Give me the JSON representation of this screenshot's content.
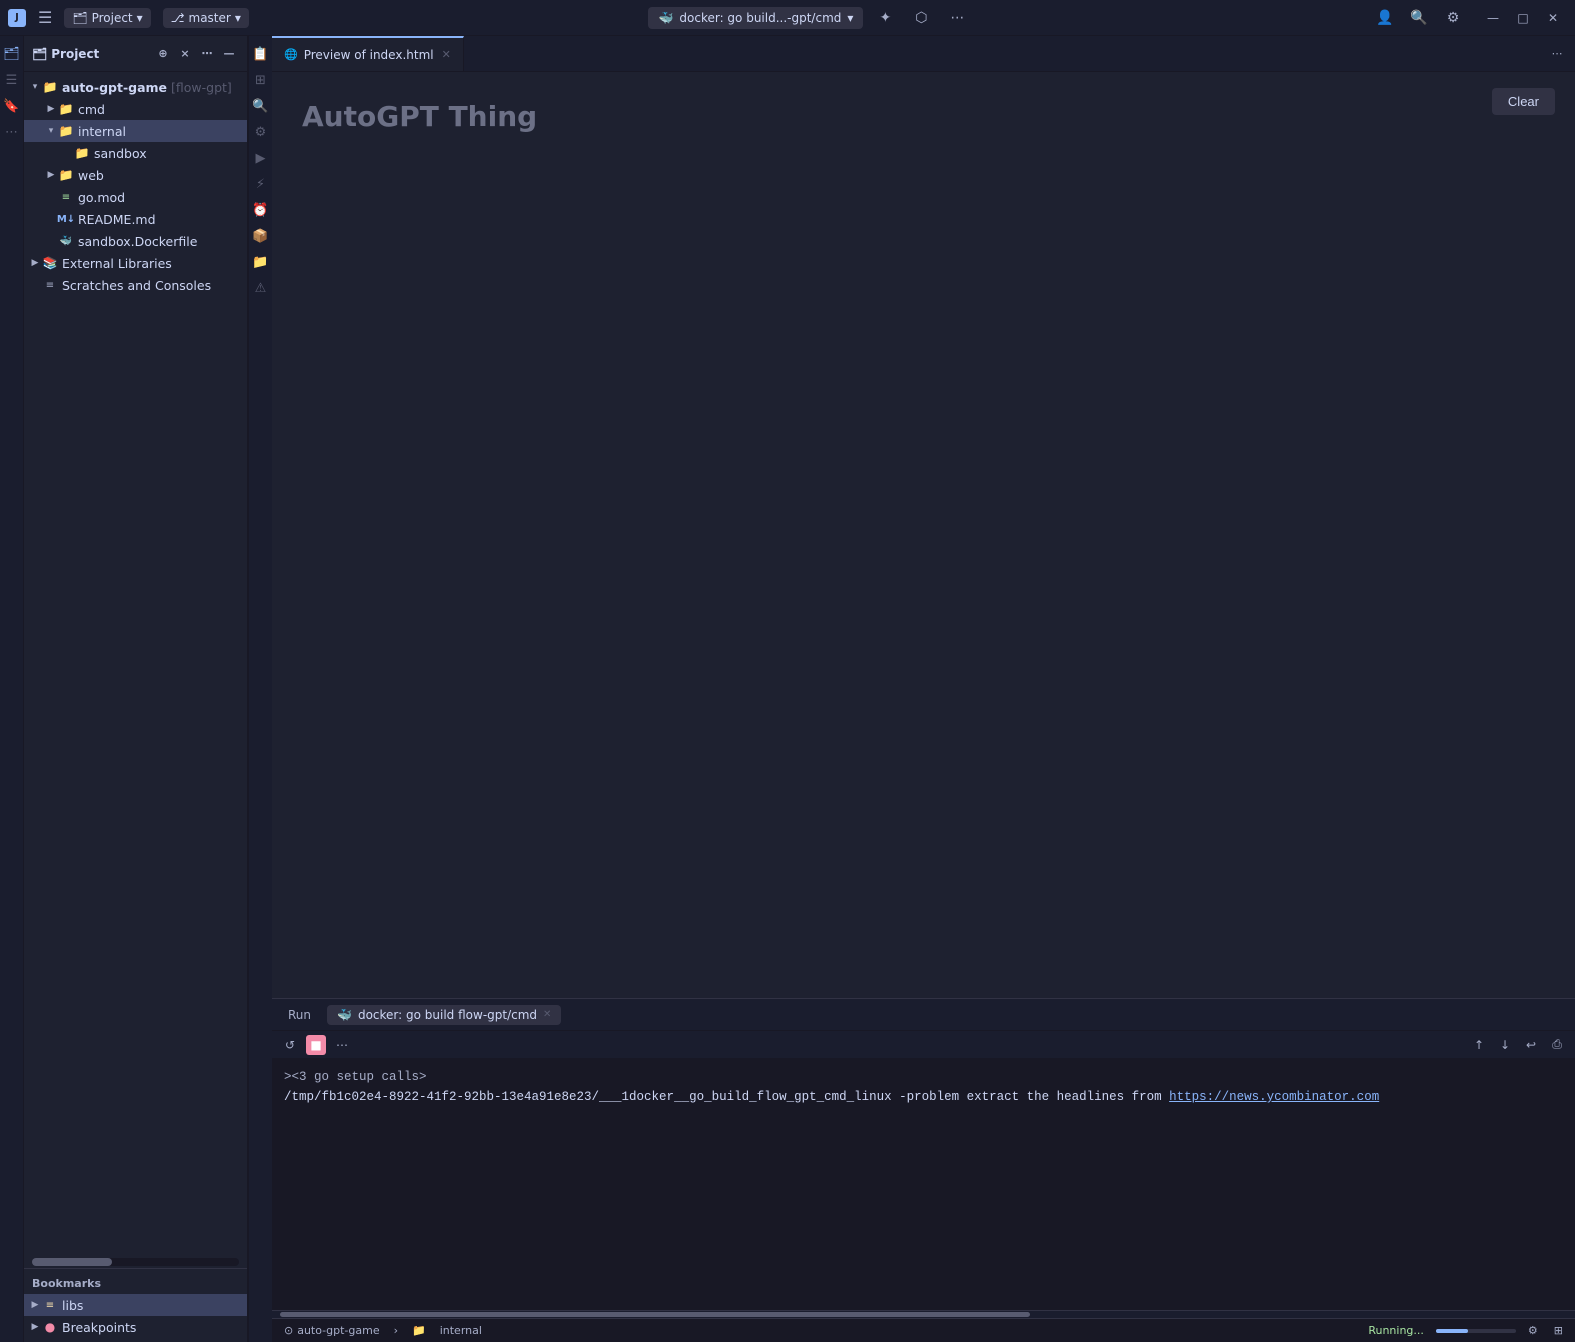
{
  "titlebar": {
    "logo": "J",
    "menu_icon": "☰",
    "project_label": "Project",
    "project_dropdown": "▾",
    "branch_icon": "⎇",
    "branch_name": "master",
    "branch_dropdown": "▾",
    "run_tab_icon": "🐳",
    "run_tab_label": "docker: go build...-gpt/cmd",
    "run_tab_dropdown": "▾",
    "actions": {
      "ai_icon": "✦",
      "plugin_icon": "⬡",
      "more_icon": "⋯",
      "profile_icon": "👤",
      "search_icon": "🔍",
      "settings_icon": "⚙",
      "minimize": "—",
      "maximize": "□",
      "close": "✕"
    }
  },
  "file_panel": {
    "title": "Project",
    "header_actions": [
      "⊕",
      "×",
      "⋯",
      "—"
    ],
    "tree": [
      {
        "level": 0,
        "type": "folder-open",
        "label": "auto-gpt-game [flow-gpt]",
        "chevron": "▾",
        "has_bold": true
      },
      {
        "level": 1,
        "type": "folder",
        "label": "cmd",
        "chevron": "▶"
      },
      {
        "level": 1,
        "type": "folder-open",
        "label": "internal",
        "chevron": "▾",
        "selected": true
      },
      {
        "level": 2,
        "type": "folder",
        "label": "sandbox",
        "chevron": ""
      },
      {
        "level": 1,
        "type": "folder",
        "label": "web",
        "chevron": "▶"
      },
      {
        "level": 1,
        "type": "gomod",
        "label": "go.mod",
        "chevron": ""
      },
      {
        "level": 1,
        "type": "md",
        "label": "README.md",
        "chevron": ""
      },
      {
        "level": 1,
        "type": "docker",
        "label": "sandbox.Dockerfile",
        "chevron": ""
      },
      {
        "level": 0,
        "type": "ext-lib",
        "label": "External Libraries",
        "chevron": "▶"
      },
      {
        "level": 0,
        "type": "scratches",
        "label": "Scratches and Consoles",
        "chevron": ""
      }
    ]
  },
  "bookmarks": {
    "header": "Bookmarks",
    "items": [
      {
        "label": "libs",
        "type": "libs",
        "chevron": "▶"
      },
      {
        "label": "Breakpoints",
        "type": "breakpoint",
        "chevron": "▶"
      }
    ]
  },
  "tabs": [
    {
      "label": "Preview of index.html",
      "active": true,
      "closeable": true
    }
  ],
  "preview": {
    "title": "AutoGPT Thing",
    "clear_button": "Clear"
  },
  "terminal": {
    "tabs": [
      {
        "label": "Run",
        "active": false
      },
      {
        "label": "docker: go build flow-gpt/cmd",
        "active": true,
        "closeable": true
      }
    ],
    "prompt_line": "><3 go setup calls>",
    "output_line_pre": "/tmp/fb1c02e4-8922-41f2-92bb-13e4a91e8e23/___1docker__go_build_flow_gpt_cmd_linux -problem extract the headlines from ",
    "output_link": "https://news.ycombinator.com",
    "toolbar_buttons": [
      "↺",
      "■",
      "⋯"
    ]
  },
  "status_bar": {
    "left": [
      {
        "icon": "⊙",
        "label": "auto-gpt-game"
      },
      {
        "icon": "▶",
        "label": ""
      },
      {
        "icon": "📁",
        "label": "internal"
      }
    ],
    "right": [
      {
        "label": "Running..."
      },
      {
        "label": "progress"
      },
      {
        "icon": "⚙",
        "label": ""
      },
      {
        "icon": "⊞",
        "label": ""
      }
    ]
  },
  "sidebar_icons_left": [
    "🗂",
    "☰",
    "🔖",
    "⋯"
  ],
  "sidebar_icons_right": [
    "📋",
    "⊞",
    "🔍",
    "⚙",
    "▶",
    "⚡",
    "⏰",
    "📦",
    "📁",
    "⚠"
  ]
}
